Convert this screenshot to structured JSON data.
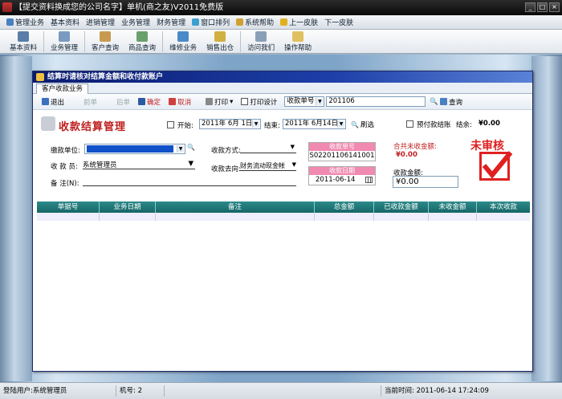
{
  "window": {
    "title": "【提交资料换成您的公司名字】单机(商之友)V2011免费版"
  },
  "menu": [
    "管理业务",
    "基本资料",
    "进销管理",
    "业务管理",
    "财务管理",
    "窗口排列",
    "系统帮助",
    "上一皮肤",
    "下一皮肤"
  ],
  "toolbar": [
    "基本资料",
    "业务管理",
    "客户查询",
    "商品查询",
    "维修业务",
    "销售出仓",
    "访问我们",
    "操作帮助"
  ],
  "dialog": {
    "title": "结算时请核对结算金额和收付款账户",
    "tab": "客户收款业务",
    "buttons": {
      "exit": "退出",
      "prev": "前单",
      "next": "后单",
      "confirm": "确定",
      "cancel": "取消",
      "print": "打印",
      "print_design": "打印设计",
      "search": "查询",
      "refresh": "刷选"
    },
    "search_field": "收款单号",
    "search_value": "201106",
    "heading": "收款结算管理",
    "start_label": "开始:",
    "start_date": "2011年 6月 1日",
    "end_label": "结束:",
    "end_date": "2011年 6月14日",
    "prepay_label": "预付款结账",
    "balance_label": "结余:",
    "balance_value": "¥0.00",
    "payer_label": "缴款单位:",
    "payer_value": "",
    "collector_label": "收 款 员:",
    "collector_value": "系统管理员",
    "note_label": "备 注(N):",
    "method_label": "收款方式:",
    "method_value": "",
    "flow_label": "收款去向:",
    "flow_value": "财务流动现金帐",
    "receipt_no_label": "收款单号",
    "receipt_no": "S02201106141001",
    "receipt_date_label": "收款日期",
    "receipt_date": "2011-06-14",
    "unpaid_label": "合共未收金额:",
    "unpaid_value": "¥0.00",
    "amount_label": "收款金额:",
    "amount_value": "¥0.00",
    "stamp": "未审核"
  },
  "table": {
    "columns": [
      "单据号",
      "业务日期",
      "备注",
      "总金额",
      "已收款金额",
      "未收金额",
      "本次收款"
    ]
  },
  "status": {
    "user_label": "登陆用户:",
    "user": "系统管理员",
    "machine_label": "机号:",
    "machine": "2",
    "time_label": "当前时间:",
    "time": "2011-06-14 17:24:09"
  },
  "colors": {
    "title_red": "#c02020",
    "grid_header": "#1f7a7a",
    "stamp_red": "#e02020"
  }
}
